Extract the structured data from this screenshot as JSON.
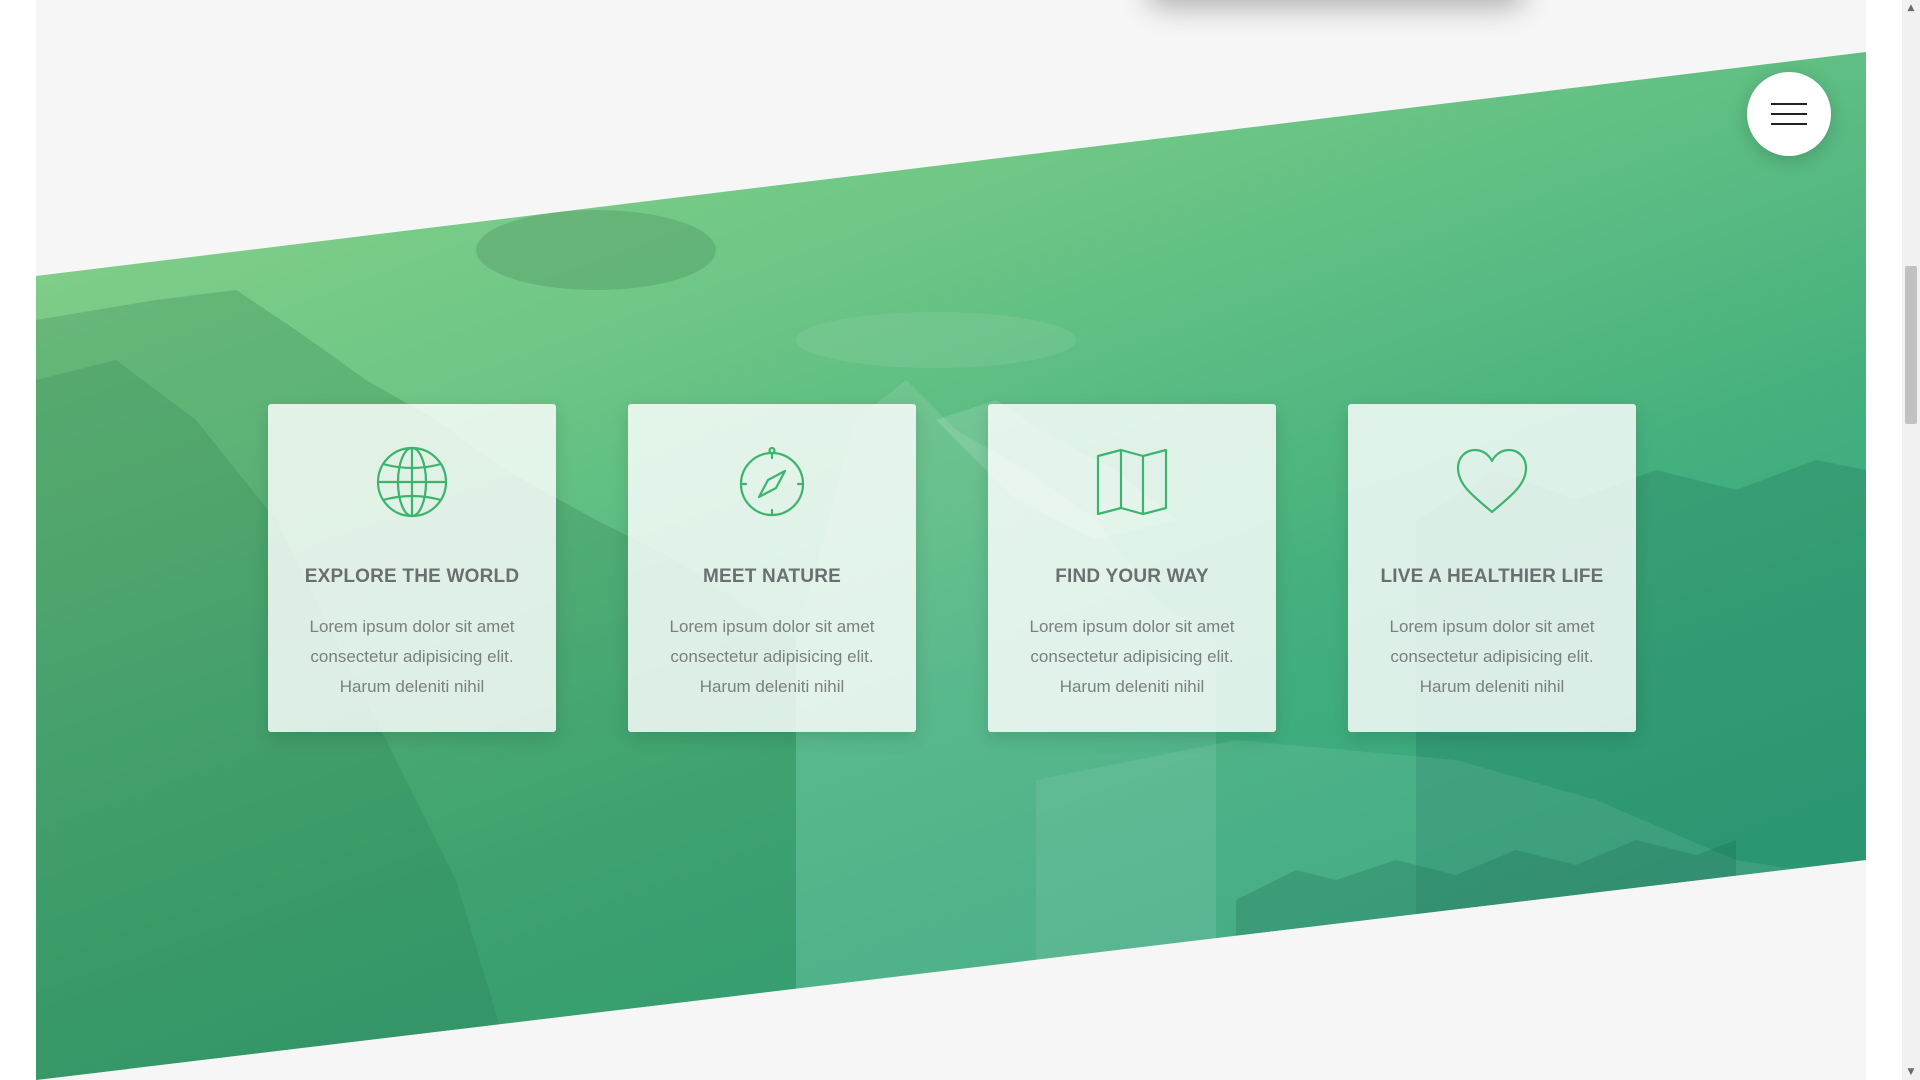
{
  "menu": {
    "icon": "hamburger-menu-icon"
  },
  "colors": {
    "accent": "#3cb46e",
    "hero_gradient_start": "#8fd48a",
    "hero_gradient_end": "#279e7a",
    "card_title": "#6a6f70",
    "card_text": "#7a7f80",
    "page_background": "#f6f6f6"
  },
  "features": [
    {
      "icon": "globe-icon",
      "title": "EXPLORE THE WORLD",
      "text": "Lorem ipsum dolor sit amet consectetur adipisicing elit. Harum deleniti nihil"
    },
    {
      "icon": "compass-icon",
      "title": "MEET NATURE",
      "text": "Lorem ipsum dolor sit amet consectetur adipisicing elit. Harum deleniti nihil"
    },
    {
      "icon": "map-icon",
      "title": "FIND YOUR WAY",
      "text": "Lorem ipsum dolor sit amet consectetur adipisicing elit. Harum deleniti nihil"
    },
    {
      "icon": "heart-icon",
      "title": "LIVE A HEALTHIER LIFE",
      "text": "Lorem ipsum dolor sit amet consectetur adipisicing elit. Harum deleniti nihil"
    }
  ],
  "scrollbar": {
    "up_arrow": "▲",
    "down_arrow": "▼"
  }
}
